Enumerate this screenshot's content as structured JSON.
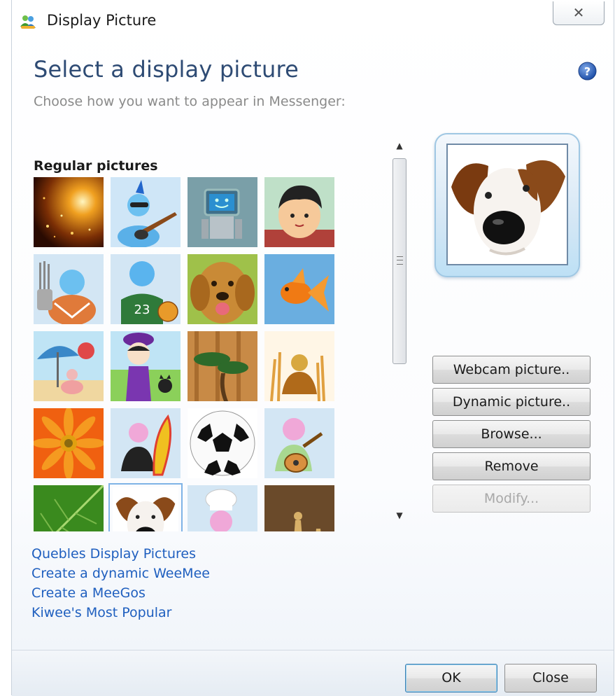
{
  "window": {
    "title": "Display Picture",
    "close_glyph": "✕"
  },
  "header": {
    "heading": "Select a display picture",
    "subtitle": "Choose how you want to appear in Messenger:",
    "help_icon": "help-icon"
  },
  "gallery": {
    "section_label": "Regular pictures",
    "selected_index": 17,
    "tiles": [
      {
        "name": "sparkles",
        "icon": "sparkles-icon"
      },
      {
        "name": "guitar-player",
        "icon": "guitar-player-icon"
      },
      {
        "name": "robot",
        "icon": "robot-icon"
      },
      {
        "name": "boy",
        "icon": "boy-icon"
      },
      {
        "name": "golfer",
        "icon": "golfer-icon"
      },
      {
        "name": "basketball-player",
        "icon": "basketball-player-icon"
      },
      {
        "name": "golden-retriever",
        "icon": "golden-retriever-icon"
      },
      {
        "name": "goldfish",
        "icon": "goldfish-icon"
      },
      {
        "name": "beach-umbrella",
        "icon": "beach-umbrella-icon"
      },
      {
        "name": "girl-with-cat",
        "icon": "girl-with-cat-icon"
      },
      {
        "name": "bonsai",
        "icon": "bonsai-icon"
      },
      {
        "name": "autumn-figure",
        "icon": "autumn-figure-icon"
      },
      {
        "name": "orange-gerbera",
        "icon": "gerbera-flower-icon"
      },
      {
        "name": "surfboard-figure",
        "icon": "surfboard-icon"
      },
      {
        "name": "soccer-ball",
        "icon": "soccer-ball-icon"
      },
      {
        "name": "acoustic-guitar-figure",
        "icon": "acoustic-guitar-icon"
      },
      {
        "name": "green-leaf",
        "icon": "leaf-icon"
      },
      {
        "name": "dog",
        "icon": "dog-icon"
      },
      {
        "name": "chef",
        "icon": "chef-icon"
      },
      {
        "name": "chess-pieces",
        "icon": "chess-icon"
      }
    ]
  },
  "scrollbar": {
    "up_glyph": "▲",
    "down_glyph": "▼"
  },
  "preview": {
    "icon": "dog-icon"
  },
  "actions": {
    "webcam": "Webcam picture..",
    "dynamic": "Dynamic picture..",
    "browse": "Browse...",
    "remove": "Remove",
    "modify": "Modify..."
  },
  "links": [
    "Quebles Display Pictures",
    "Create a dynamic WeeMee",
    "Create a MeeGos",
    "Kiwee's Most Popular"
  ],
  "footer": {
    "ok": "OK",
    "close": "Close"
  },
  "colors": {
    "heading": "#2e4b74",
    "link": "#1f5fbf",
    "selection": "#7fb3e6"
  }
}
